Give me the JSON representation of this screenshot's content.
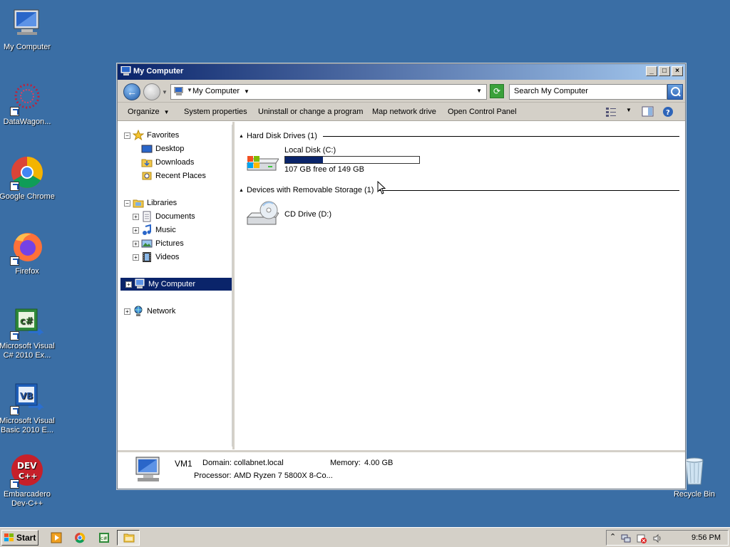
{
  "desktop": {
    "icons": [
      {
        "label": "My Computer"
      },
      {
        "label": "DataWagon..."
      },
      {
        "label": "Google Chrome"
      },
      {
        "label": "Firefox"
      },
      {
        "label": "Microsoft Visual C# 2010 Ex..."
      },
      {
        "label": "Microsoft Visual Basic 2010 E..."
      },
      {
        "label": "Embarcadero Dev-C++"
      },
      {
        "label": "Recycle Bin"
      }
    ]
  },
  "window": {
    "title": "My Computer",
    "buttons": {
      "minimize": "_",
      "maximize": "□",
      "close": "×"
    },
    "address": {
      "crumb": "My Computer"
    },
    "search": {
      "placeholder": "Search My Computer"
    },
    "toolbar": {
      "organize": "Organize",
      "system_properties": "System properties",
      "uninstall": "Uninstall or change a program",
      "map_drive": "Map network drive",
      "control_panel": "Open Control Panel"
    },
    "nav": {
      "favorites": "Favorites",
      "desktop": "Desktop",
      "downloads": "Downloads",
      "recent": "Recent Places",
      "libraries": "Libraries",
      "documents": "Documents",
      "music": "Music",
      "pictures": "Pictures",
      "videos": "Videos",
      "computer": "My Computer",
      "network": "Network"
    },
    "groups": {
      "hdd": "Hard Disk Drives (1)",
      "removable": "Devices with Removable Storage (1)"
    },
    "drives": {
      "c": {
        "name": "Local Disk (C:)",
        "free": "107 GB free of 149 GB",
        "used_fraction": 0.28
      },
      "d": {
        "name": "CD Drive (D:)"
      }
    },
    "details": {
      "name": "VM1",
      "domain_label": "Domain:",
      "domain": "collabnet.local",
      "memory_label": "Memory:",
      "memory": "4.00 GB",
      "processor_label": "Processor:",
      "processor": "AMD Ryzen 7 5800X 8-Co..."
    }
  },
  "taskbar": {
    "start": "Start",
    "clock": "9:56 PM"
  },
  "colors": {
    "desktop": "#3a6ea5",
    "selection": "#0a246a",
    "chrome": "#d4d0c8"
  }
}
